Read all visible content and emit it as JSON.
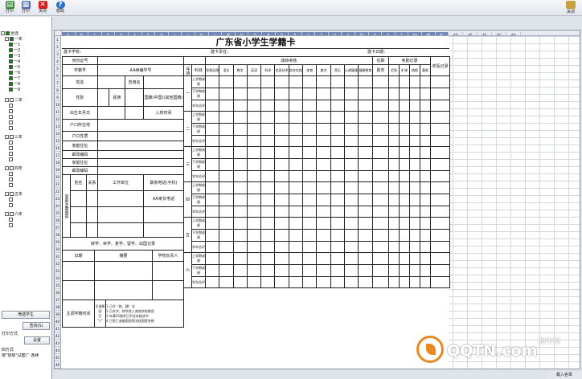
{
  "toolbar": {
    "buttons": [
      {
        "label": "打印",
        "icon": "print-icon",
        "color": "#3a8a3a"
      },
      {
        "label": "打印",
        "icon": "preview-icon",
        "color": "#4a6fb0"
      },
      {
        "label": "关闭",
        "icon": "close-icon",
        "color": "#d42020"
      },
      {
        "label": "帮助",
        "icon": "help-icon",
        "color": "#2a6fc9"
      }
    ],
    "right_button": "关闭"
  },
  "left_panel": {
    "tree_root": "全选",
    "grades": [
      "一年",
      "二年",
      "三年",
      "四年",
      "五年",
      "六年"
    ],
    "classes": [
      "一1",
      "一2",
      "一3",
      "一4",
      "一5",
      "一6",
      "一7",
      "一8",
      "一9"
    ],
    "filter_button": "筛选学生",
    "query_button": "查询(S)",
    "print_mode_label": "打印方式",
    "settings_button": "设置",
    "print_option_label": "四方式",
    "print_option_value": "按\"班级\"试套广 连续"
  },
  "sheet": {
    "columns": [
      "A",
      "B",
      "C",
      "D",
      "E",
      "F",
      "G",
      "H",
      "I",
      "J",
      "K",
      "L",
      "M",
      "N",
      "O",
      "P",
      "Q",
      "R",
      "S",
      "T",
      "U",
      "V",
      "W",
      "X",
      "Y",
      "Z",
      "AA",
      "AB",
      "AC",
      "AD",
      "AE",
      "AF",
      "AG",
      "AH"
    ],
    "row_count": 46
  },
  "form": {
    "title": "广东省小学生学籍卡",
    "school_label": "建卡学校：",
    "operator_label": "建卡责任：",
    "date_label": "建卡日期：",
    "left_fields": [
      "身份证号",
      "学籍号",
      "姓名",
      "性别",
      "出生年月日",
      "户口所在地",
      "户口性质",
      "家庭住址",
      "邮政编码",
      "家庭住址",
      "邮政编码"
    ],
    "id_value": "AA续编学号",
    "name_used_label": "曾用名",
    "ethnic_label": "民族",
    "nationality_label": "国籍(中国)(其他国籍)",
    "enroll_label": "入校时间",
    "family_headers": [
      "姓名",
      "关系",
      "工作单位",
      "联系电话(手机)"
    ],
    "family_title": "家庭主要成员",
    "family_note": "AA家长电话",
    "transfer_title": "转学、休学、复学、留学、出国记录",
    "transfer_headers": [
      "日期",
      "摘要",
      "学校负责人"
    ],
    "leave_label": "主调学籍时间",
    "leave_note": [
      "主调原因",
      "打",
      "\"√\""
    ],
    "leave_options": [
      "1 已毕（结、肄）业",
      "2 已升学，转学进入其他学校就读",
      "3 年满15周岁已不在本校读书",
      "4 已死亡或被国务院无权国家系统"
    ],
    "grades_title": "成绩考核",
    "grade_col_header": "科目",
    "year_label": "年级",
    "subjects": [
      "思想品德",
      "语文",
      "数学",
      "英语",
      "科学",
      "信息技术",
      "综合实践",
      "体育",
      "美术",
      "音乐",
      "心理健康",
      "健康教育"
    ],
    "semester_rows": [
      "上学期成绩",
      "下学期成绩",
      "学年总评"
    ],
    "grade_years": [
      "一",
      "二",
      "三",
      "四",
      "五",
      "六"
    ],
    "attend_title": "考勤记录",
    "duty_label": "任职",
    "duty_col": "职务",
    "attend_cols": [
      "迟到",
      "旷课",
      "病假",
      "事假"
    ],
    "award_col": "奖惩记录"
  },
  "status_bar": "载入名单",
  "watermark": {
    "text": "QQTN",
    "domain": ".com",
    "cn": "腾牛网"
  }
}
